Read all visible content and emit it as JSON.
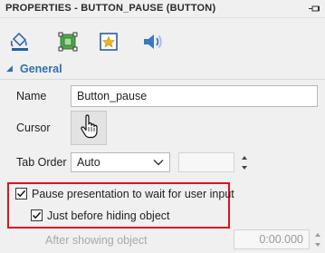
{
  "panel": {
    "title": "PROPERTIES - BUTTON_PAUSE (BUTTON)"
  },
  "toolbar": {
    "icons": [
      "paint-bucket-icon",
      "transform-icon",
      "star-frame-icon",
      "speaker-icon"
    ]
  },
  "section": {
    "title": "General"
  },
  "fields": {
    "name_label": "Name",
    "name_value": "Button_pause",
    "cursor_label": "Cursor",
    "taborder_label": "Tab Order",
    "taborder_value": "Auto",
    "taborder_number": ""
  },
  "options": {
    "pause_label": "Pause presentation to wait for user input",
    "pause_checked": true,
    "before_hiding_label": "Just before hiding object",
    "before_hiding_checked": true,
    "after_showing_label": "After showing object",
    "after_showing_value": "0:00.000"
  },
  "colors": {
    "accent": "#2f6fb5",
    "highlight": "#e3111b",
    "panel_bg": "#f0f0f0",
    "disabled_text": "#a8a8a8"
  }
}
